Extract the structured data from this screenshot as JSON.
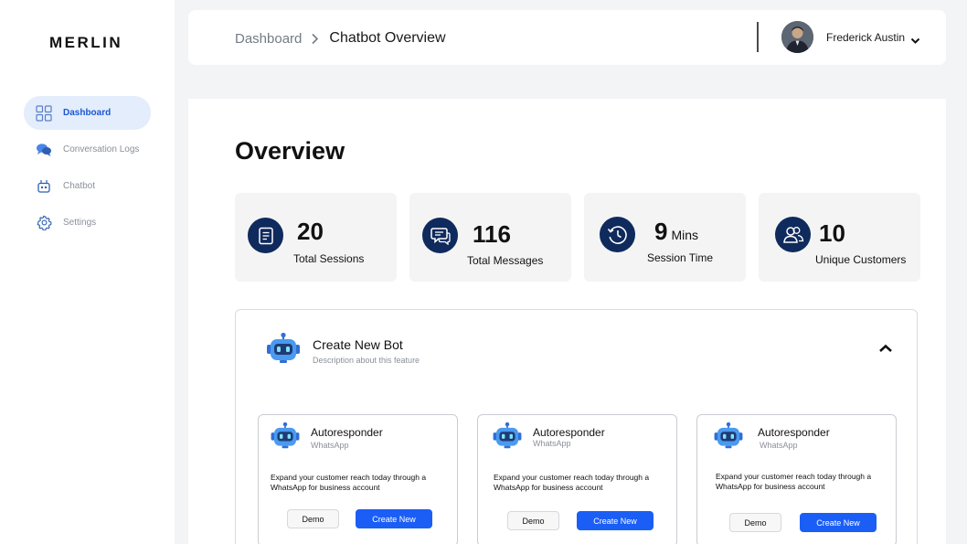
{
  "app": {
    "logo": "MERLIN"
  },
  "sidebar": {
    "items": [
      {
        "label": "Dashboard",
        "icon": "grid-icon"
      },
      {
        "label": "Conversation Logs",
        "icon": "chat-bubbles-icon"
      },
      {
        "label": "Chatbot",
        "icon": "robot-icon"
      },
      {
        "label": "Settings",
        "icon": "gear-icon"
      }
    ]
  },
  "header": {
    "breadcrumb_root": "Dashboard",
    "breadcrumb_current": "Chatbot Overview",
    "user_name": "Frederick Austin"
  },
  "main": {
    "title": "Overview",
    "stats": [
      {
        "value": "20",
        "unit": "",
        "label": "Total Sessions",
        "icon": "document-icon"
      },
      {
        "value": "116",
        "unit": "",
        "label": "Total Messages",
        "icon": "message-icon"
      },
      {
        "value": "9",
        "unit": "Mins",
        "label": "Session Time",
        "icon": "clock-icon"
      },
      {
        "value": "10",
        "unit": "",
        "label": "Unique Customers",
        "icon": "users-icon"
      }
    ],
    "create_bot": {
      "title": "Create New Bot",
      "description": "Description about this feature",
      "cards": [
        {
          "title": "Autoresponder",
          "subtitle": "WhatsApp",
          "description": "Expand your customer reach today through a WhatsApp for business account",
          "demo_label": "Demo",
          "create_label": "Create New"
        },
        {
          "title": "Autoresponder",
          "subtitle": "WhatsApp",
          "description": "Expand your customer reach today through a WhatsApp for business account",
          "demo_label": "Demo",
          "create_label": "Create New"
        },
        {
          "title": "Autoresponder",
          "subtitle": "WhatsApp",
          "description": "Expand your customer reach today through a WhatsApp for business account",
          "demo_label": "Demo",
          "create_label": "Create New"
        }
      ]
    }
  },
  "colors": {
    "accent": "#1b5ef5",
    "navy": "#0f2a5c",
    "active_bg": "#e4edfb"
  }
}
